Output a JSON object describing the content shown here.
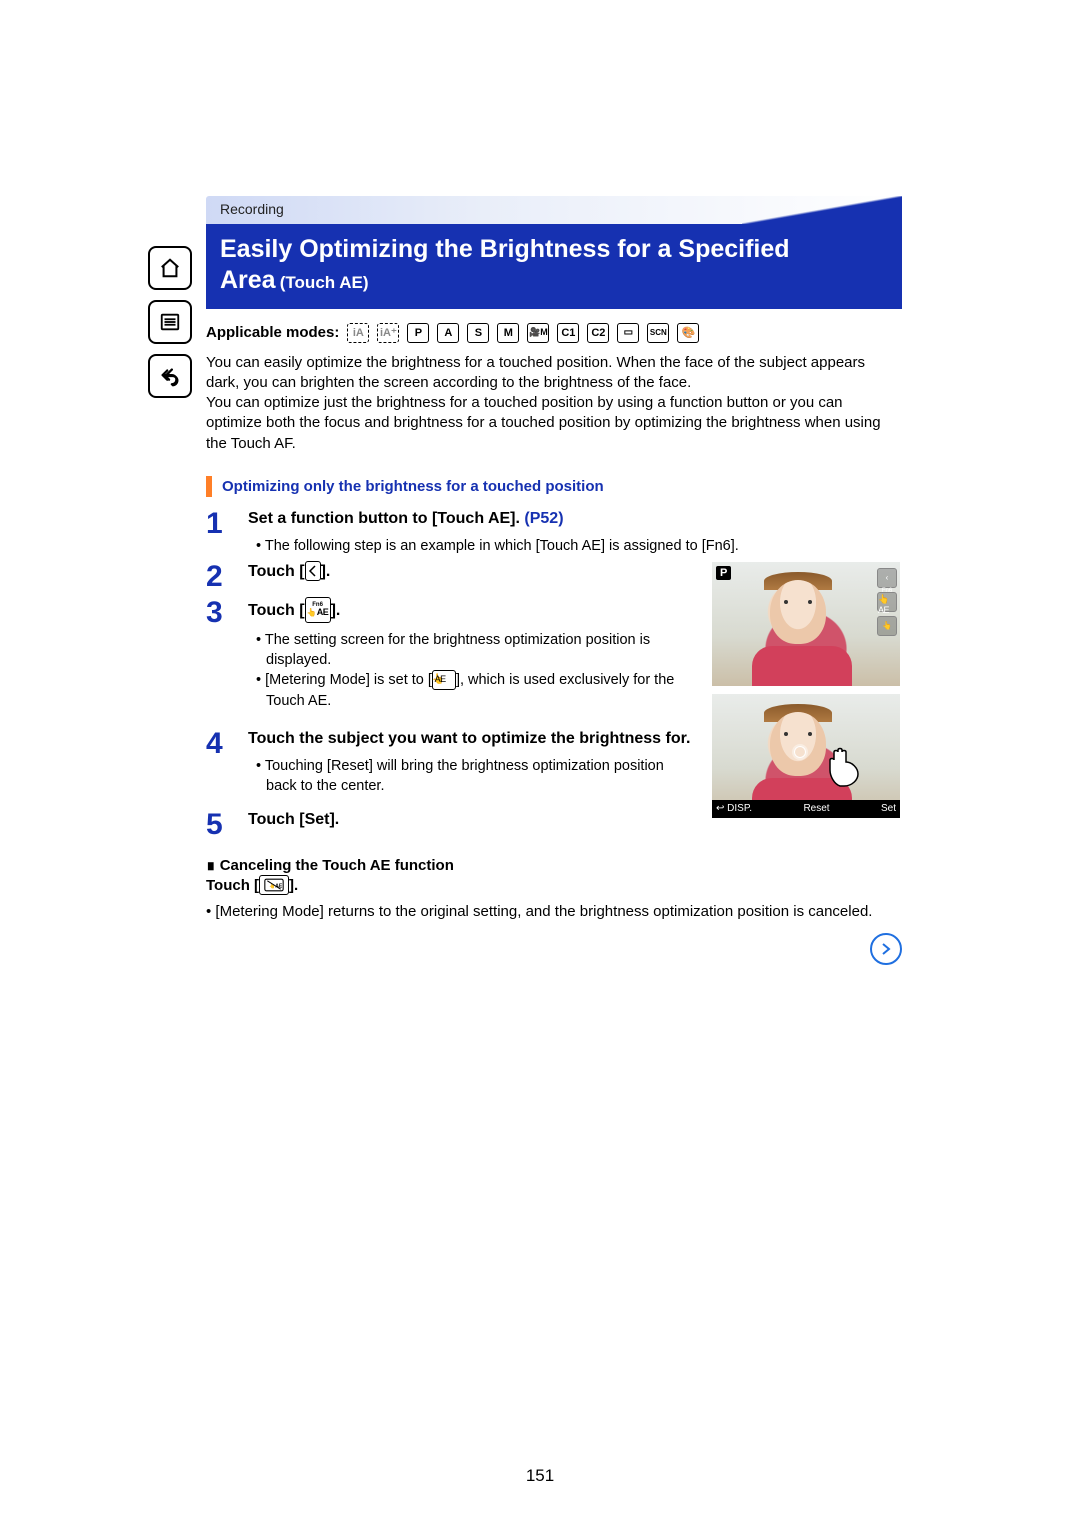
{
  "section": "Recording",
  "title_line1": "Easily Optimizing the Brightness for a Specified",
  "title_line2": "Area",
  "title_sub": "(Touch AE)",
  "applicable_label": "Applicable modes:",
  "modes": [
    "iA",
    "iA+",
    "P",
    "A",
    "S",
    "M",
    "🎥M",
    "C1",
    "C2",
    "□",
    "SCN",
    "🎨"
  ],
  "intro": "You can easily optimize the brightness for a touched position. When the face of the subject appears dark, you can brighten the screen according to the brightness of the face.\nYou can optimize just the brightness for a touched position by using a function button or you can optimize both the focus and brightness for a touched position by optimizing the brightness when using the Touch AF.",
  "section_heading": "Optimizing only the brightness for a touched position",
  "steps": {
    "s1": {
      "num": "1",
      "title_a": "Set a function button to [Touch AE]. ",
      "link": "(P52)",
      "bullets": [
        "The following step is an example in which [Touch AE] is assigned to [Fn6]."
      ]
    },
    "s2": {
      "num": "2",
      "title": "Touch [",
      "title_after": "]."
    },
    "s3": {
      "num": "3",
      "title": "Touch [",
      "title_after": "].",
      "bullets": [
        "The setting screen for the brightness optimization position is displayed.",
        "[Metering Mode] is set to [  ], which is used exclusively for the Touch AE."
      ]
    },
    "s4": {
      "num": "4",
      "title": "Touch the subject you want to optimize the brightness for.",
      "bullets": [
        "Touching [Reset] will bring the brightness optimization position back to the center."
      ]
    },
    "s5": {
      "num": "5",
      "title": "Touch [Set]."
    }
  },
  "fn_icon": {
    "top": "Fn6",
    "bottom": "AE"
  },
  "screenshot1": {
    "badge": "P",
    "right_icons": [
      "⇕",
      "Fn6",
      "AE"
    ]
  },
  "screenshot2": {
    "disp": "DISP.",
    "reset": "Reset",
    "set": "Set",
    "back": "↩"
  },
  "cancel_heading": "∎ Canceling the Touch AE function",
  "cancel_line": "Touch [",
  "cancel_line_after": "].",
  "cancel_note_bullet": "[Metering Mode] returns to the original setting, and the brightness optimization position is canceled.",
  "page_number": "151"
}
